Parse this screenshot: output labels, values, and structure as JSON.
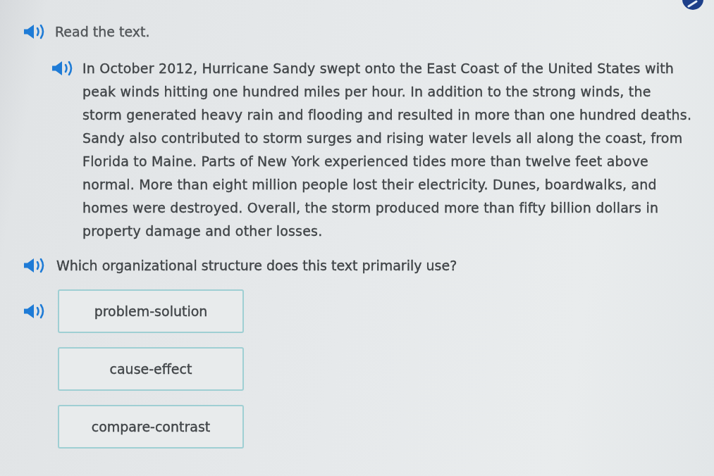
{
  "instruction": {
    "text": "Read the text."
  },
  "passage": {
    "text": "In October 2012, Hurricane Sandy swept onto the East Coast of the United States with peak winds hitting one hundred miles per hour. In addition to the strong winds, the storm generated heavy rain and flooding and resulted in more than one hundred deaths. Sandy also contributed to storm surges and rising water levels all along the coast, from Florida to Maine. Parts of New York experienced tides more than twelve feet above normal. More than eight million people lost their electricity. Dunes, boardwalks, and homes were destroyed. Overall, the storm produced more than fifty billion dollars in property damage and other losses."
  },
  "question": {
    "text": "Which organizational structure does this text primarily use?"
  },
  "options": [
    {
      "text": "problem-solution",
      "audio": true,
      "selected": false
    },
    {
      "text": "cause-effect",
      "audio": false,
      "selected": false
    },
    {
      "text": "compare-contrast",
      "audio": false,
      "selected": false
    }
  ]
}
